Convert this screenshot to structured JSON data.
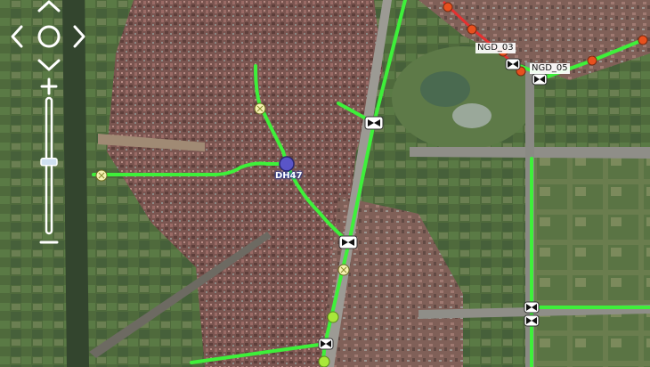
{
  "labels": {
    "dh47": "DH47",
    "ngd03": "NGD_03",
    "ngd05": "NGD_05"
  },
  "controls": {
    "pan_up": "pan-up",
    "pan_down": "pan-down",
    "pan_left": "pan-left",
    "pan_right": "pan-right",
    "zoom_in": "+",
    "zoom_out": "−",
    "zoom_level_fraction": 0.53
  },
  "colors": {
    "line": "#3ef03a",
    "valve": "#f4f0b0",
    "orange_node": "#e8501e",
    "red_line": "#e53030",
    "marker_purple": "#5a55c8",
    "junction": "#ffffff"
  }
}
